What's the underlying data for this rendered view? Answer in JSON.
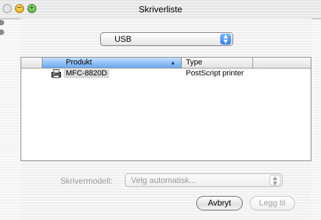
{
  "window": {
    "title": "Skriverliste"
  },
  "connection_popup": {
    "value": "USB"
  },
  "printer_list": {
    "columns": [
      "Produkt",
      "Type"
    ],
    "rows": [
      {
        "product": "MFC-8820D",
        "type": "PostScript printer"
      }
    ]
  },
  "model": {
    "label": "Skrivermodell:",
    "value": "Velg automatisk..."
  },
  "buttons": {
    "cancel": "Avbryt",
    "add": "Legg til"
  },
  "icons": {
    "printer": "printer-icon",
    "sort": "sort-ascending-icon",
    "popup": "popup-arrows-icon"
  },
  "colors": {
    "accent": "#2d7fe6",
    "header_selected": "#6aa6ef"
  }
}
